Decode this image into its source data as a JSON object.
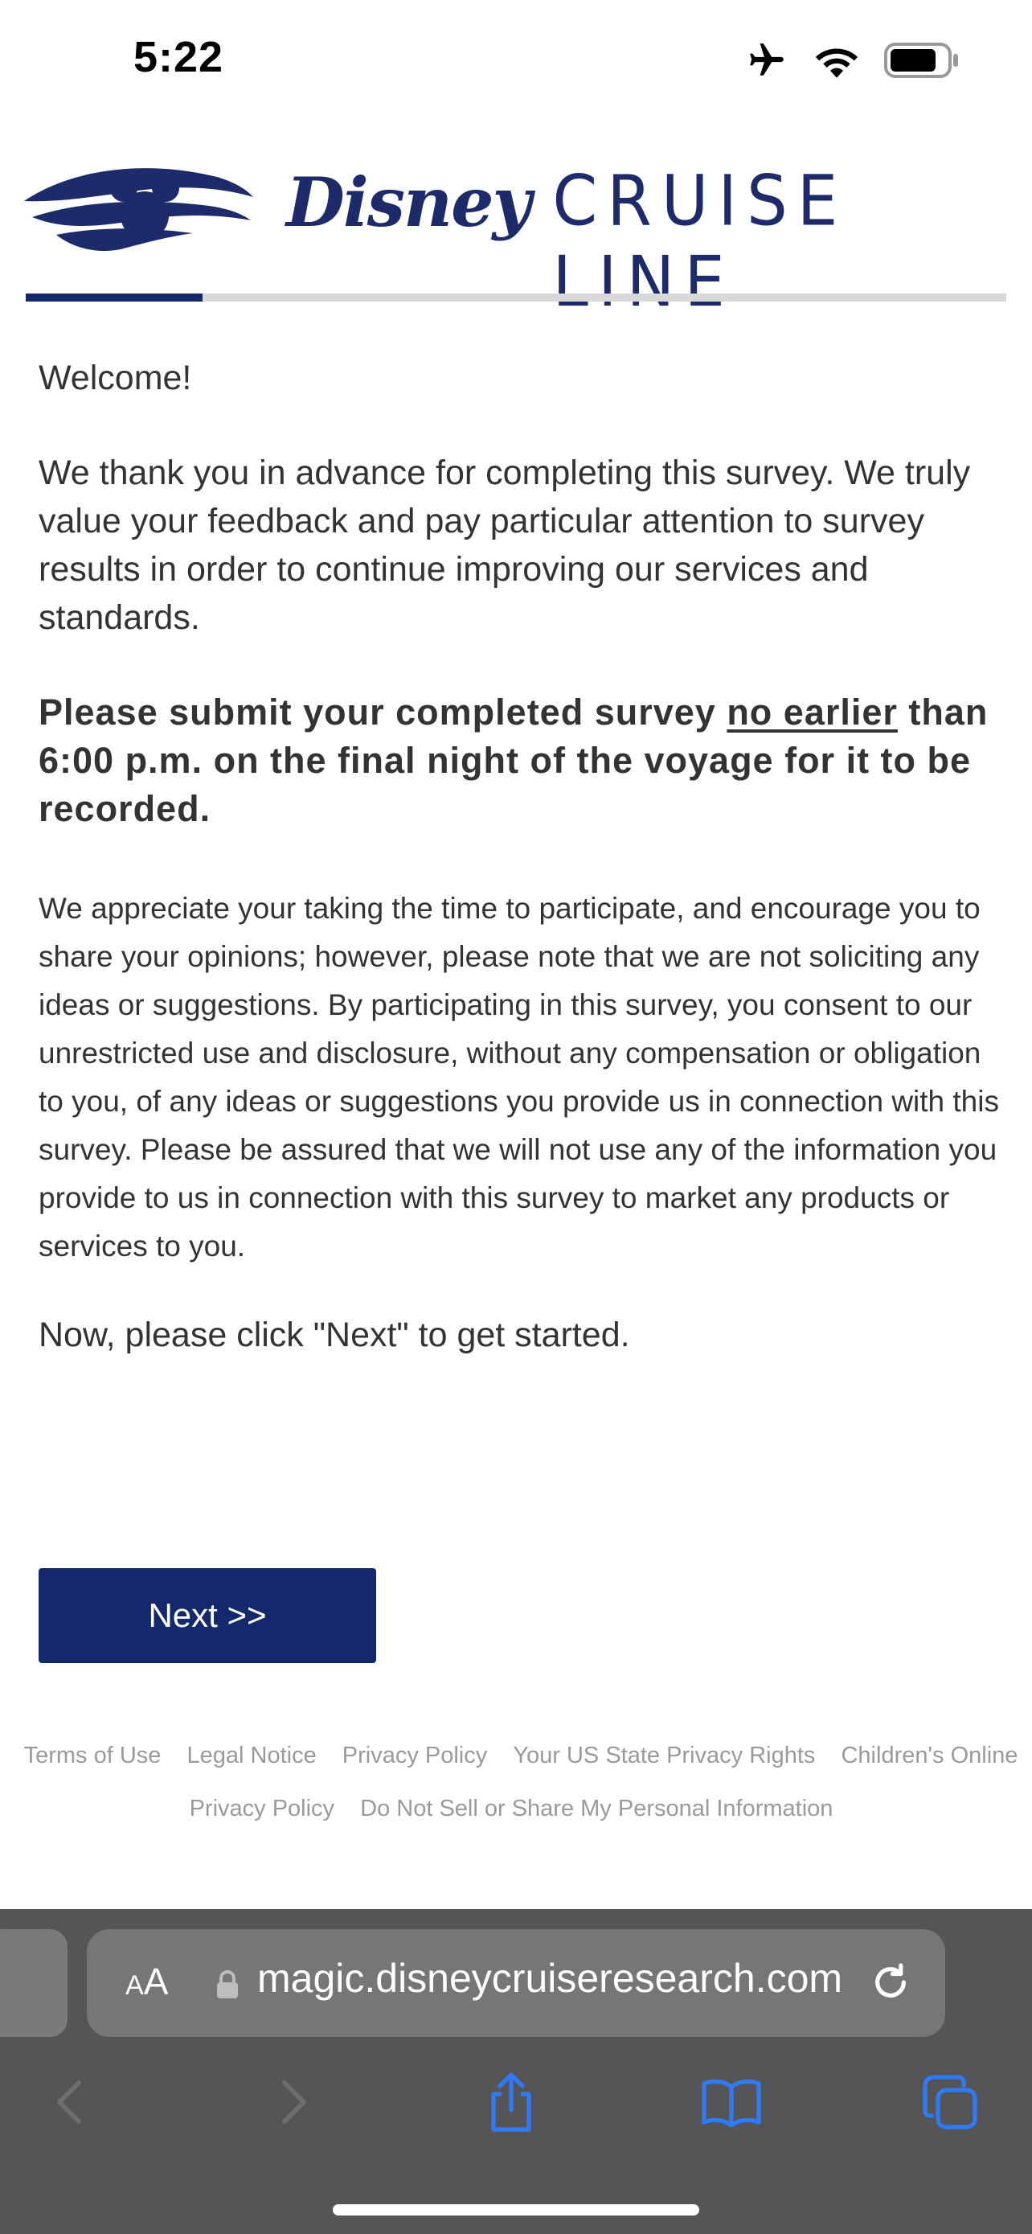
{
  "status_bar": {
    "time": "5:22",
    "icons": [
      "airplane-icon",
      "wifi-icon",
      "battery-icon"
    ]
  },
  "header": {
    "logo_disney": "Disney",
    "logo_cruise": "CRUISE LINE",
    "brand_color": "#1d2b6b"
  },
  "progress": {
    "fraction": 0.18,
    "fill_color": "#13296b",
    "track_color": "#d9d9d9"
  },
  "content": {
    "welcome": "Welcome!",
    "intro": "We thank you in advance for completing this survey. We truly value your feedback and pay particular attention to survey results in order to continue improving our services and standards.",
    "notice_before": "Please submit your completed survey ",
    "notice_underlined": "no earlier",
    "notice_after": " than 6:00 p.m. on the final night of the voyage for it to be recorded.",
    "legal": "We appreciate your taking the time to participate, and encourage you to share your opinions; however, please note that we are not soliciting any ideas or suggestions. By participating in this survey, you consent to our unrestricted use and disclosure, without any compensation or obligation to you, of any ideas or suggestions you provide us in connection with this survey. Please be assured that we will not use any of the information you provide to us in connection with this survey to market any products or services to you.",
    "now": "Now, please click \"Next\" to get started."
  },
  "next_button": {
    "label": "Next  >>",
    "color": "#13296b"
  },
  "footer": {
    "links": [
      "Terms of Use",
      "Legal Notice",
      "Privacy Policy",
      "Your US State Privacy Rights",
      "Children's Online Privacy Policy",
      "Do Not Sell or Share My Personal Information"
    ]
  },
  "browser": {
    "aa_label_small": "A",
    "aa_label_large": "A",
    "url": "magic.disneycruiseresearch.com",
    "toolbar_icons": [
      "back-icon",
      "forward-icon",
      "share-icon",
      "bookmarks-icon",
      "tabs-icon"
    ],
    "accent": "#2f7bf5"
  }
}
